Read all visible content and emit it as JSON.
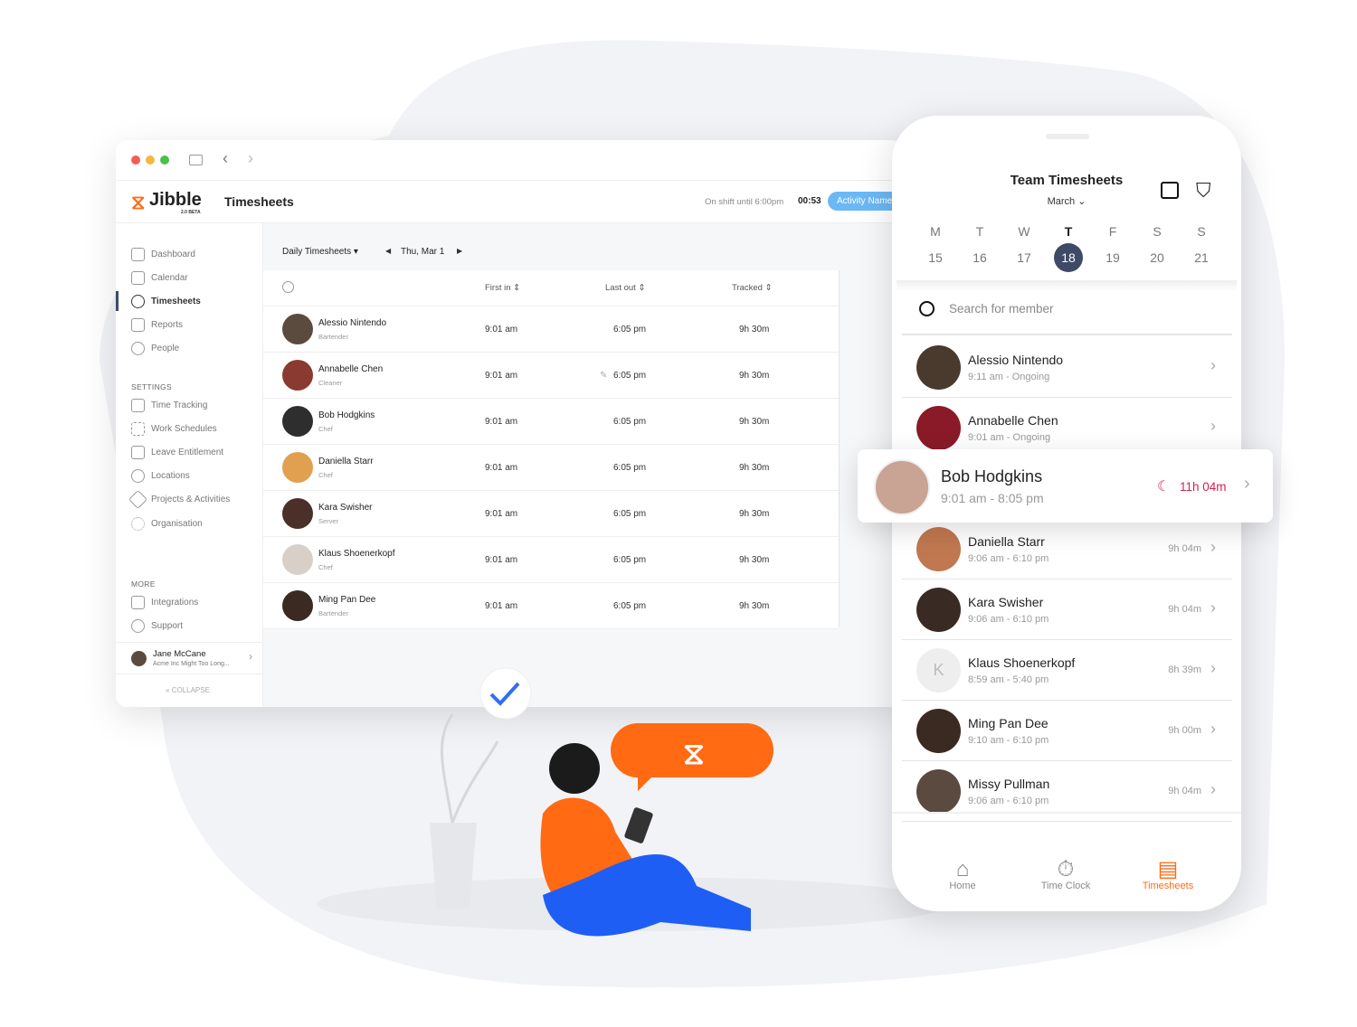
{
  "colors": {
    "brand": "#ff6a13",
    "selected_day": "#3e4a66",
    "overtime": "#d6204e",
    "activity_badge": "#6bb8f5"
  },
  "desktop": {
    "brand": "Jibble",
    "brand_sub": "2.0 BETA",
    "page_title": "Timesheets",
    "shift_text": "On shift until 6:00pm",
    "timer": "00:53",
    "activity_badge": "Activity Name",
    "sidebar": {
      "items": [
        {
          "label": "Dashboard",
          "icon": "dashboard-icon"
        },
        {
          "label": "Calendar",
          "icon": "calendar-icon"
        },
        {
          "label": "Timesheets",
          "icon": "clock-icon",
          "active": true
        },
        {
          "label": "Reports",
          "icon": "clipboard-icon"
        },
        {
          "label": "People",
          "icon": "people-icon"
        }
      ],
      "settings_heading": "SETTINGS",
      "settings": [
        {
          "label": "Time Tracking",
          "icon": "time-tracking-icon"
        },
        {
          "label": "Work Schedules",
          "icon": "schedule-icon"
        },
        {
          "label": "Leave Entitlement",
          "icon": "suitcase-icon"
        },
        {
          "label": "Locations",
          "icon": "location-icon"
        },
        {
          "label": "Projects & Activities",
          "icon": "tag-icon"
        },
        {
          "label": "Organisation",
          "icon": "gear-icon"
        }
      ],
      "more_heading": "MORE",
      "more": [
        {
          "label": "Integrations",
          "icon": "plug-icon"
        },
        {
          "label": "Support",
          "icon": "help-icon"
        }
      ],
      "user": {
        "name": "Jane McCane",
        "org": "Acme Inc Might Too Long..."
      },
      "collapse": "COLLAPSE"
    },
    "toolbar": {
      "view": "Daily Timesheets",
      "date": "Thu, Mar 1"
    },
    "table": {
      "headers": [
        "First in",
        "Last out",
        "Tracked"
      ],
      "rows": [
        {
          "name": "Alessio Nintendo",
          "role": "Bartender",
          "first_in": "9:01 am",
          "last_out": "6:05 pm",
          "tracked": "9h 30m"
        },
        {
          "name": "Annabelle Chen",
          "role": "Cleaner",
          "first_in": "9:01 am",
          "last_out": "6:05 pm",
          "tracked": "9h 30m",
          "edited": true
        },
        {
          "name": "Bob Hodgkins",
          "role": "Chef",
          "first_in": "9:01 am",
          "last_out": "6:05 pm",
          "tracked": "9h 30m"
        },
        {
          "name": "Daniella Starr",
          "role": "Chef",
          "first_in": "9:01 am",
          "last_out": "6:05 pm",
          "tracked": "9h 30m"
        },
        {
          "name": "Kara Swisher",
          "role": "Server",
          "first_in": "9:01 am",
          "last_out": "6:05 pm",
          "tracked": "9h 30m"
        },
        {
          "name": "Klaus Shoenerkopf",
          "role": "Chef",
          "first_in": "9:01 am",
          "last_out": "6:05 pm",
          "tracked": "9h 30m"
        },
        {
          "name": "Ming Pan Dee",
          "role": "Bartender",
          "first_in": "9:01 am",
          "last_out": "6:05 pm",
          "tracked": "9h 30m"
        }
      ]
    }
  },
  "phone": {
    "title": "Team Timesheets",
    "month": "March",
    "days": [
      {
        "d": "M",
        "n": "15"
      },
      {
        "d": "T",
        "n": "16"
      },
      {
        "d": "W",
        "n": "17"
      },
      {
        "d": "T",
        "n": "18",
        "selected": true
      },
      {
        "d": "F",
        "n": "19"
      },
      {
        "d": "S",
        "n": "20"
      },
      {
        "d": "S",
        "n": "21"
      }
    ],
    "search_placeholder": "Search for member",
    "members": [
      {
        "name": "Alessio Nintendo",
        "time": "9:11 am - Ongoing",
        "duration": ""
      },
      {
        "name": "Annabelle Chen",
        "time": "9:01 am - Ongoing",
        "duration": ""
      },
      {
        "name": "Bob Hodgkins",
        "time": "9:01 am - 8:05 pm",
        "duration": "11h 04m",
        "highlight": true
      },
      {
        "name": "Daniella Starr",
        "time": "9:06 am - 6:10 pm",
        "duration": "9h 04m"
      },
      {
        "name": "Kara Swisher",
        "time": "9:06 am - 6:10 pm",
        "duration": "9h 04m"
      },
      {
        "name": "Klaus Shoenerkopf",
        "time": "8:59 am - 5:40 pm",
        "duration": "8h 39m",
        "initial": "K"
      },
      {
        "name": "Ming Pan Dee",
        "time": "9:10 am - 6:10 pm",
        "duration": "9h 00m"
      },
      {
        "name": "Missy Pullman",
        "time": "9:06 am - 6:10 pm",
        "duration": "9h 04m"
      }
    ],
    "nav": [
      {
        "label": "Home",
        "icon": "home-icon"
      },
      {
        "label": "Time Clock",
        "icon": "stopwatch-icon"
      },
      {
        "label": "Timesheets",
        "icon": "timesheets-icon",
        "active": true
      }
    ]
  }
}
